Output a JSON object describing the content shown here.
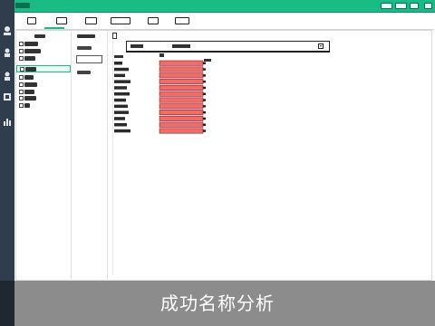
{
  "window": {
    "title": "",
    "controls": [
      "",
      "",
      "",
      ""
    ]
  },
  "toolbar": {
    "buttons": [
      "",
      "",
      "",
      "",
      "",
      ""
    ]
  },
  "rail": {
    "items": [
      "user-icon",
      "person-icon",
      "person-icon",
      "box-icon",
      "chart-icon"
    ]
  },
  "tree": {
    "nodes_count_hint": 9
  },
  "chart_data": {
    "type": "bar",
    "orientation": "horizontal",
    "categories": [
      "",
      "",
      "",
      "",
      "",
      "",
      "",
      "",
      "",
      "",
      "",
      ""
    ],
    "values": [
      1,
      1,
      1,
      1,
      1,
      1,
      1,
      1,
      1,
      1,
      1,
      1
    ],
    "bar_color": "#f26b6b"
  },
  "caption": "成功名称分析",
  "colors": {
    "accent": "#1abc86",
    "rail": "#2f3d4d",
    "bar": "#f26b6b",
    "caption_bg": "#8c8c8c"
  }
}
